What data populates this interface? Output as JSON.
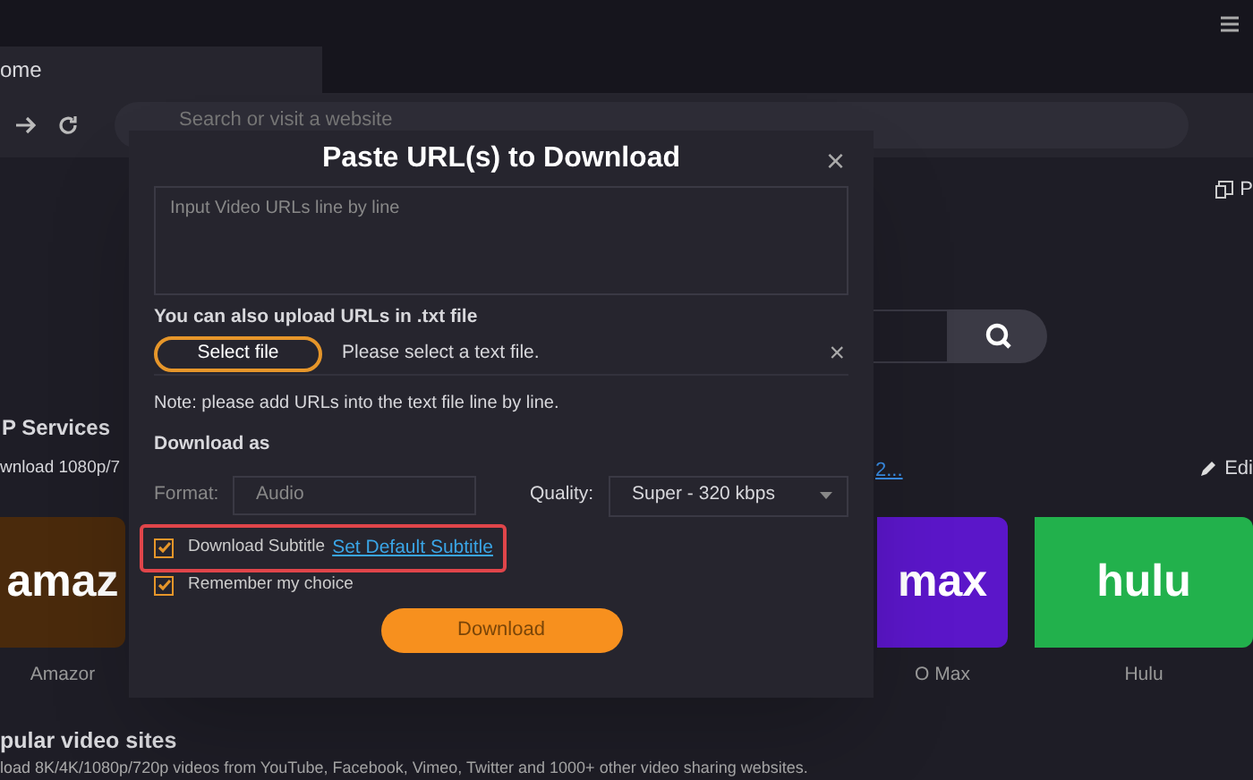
{
  "browser": {
    "tab_title": "ome",
    "address_placeholder": "Search or visit a website"
  },
  "page": {
    "top_right_label": "P",
    "section_title": "P Services",
    "section_subtitle": "wnload 1080p/7",
    "link_text": "2...",
    "edit_label": "Edi",
    "services": [
      {
        "logo_text": "amaz",
        "label": "Amazor",
        "color": "#4a2a0c"
      },
      {
        "logo_text": "max",
        "label": "O Max",
        "color": "#5b16c9"
      },
      {
        "logo_text": "hulu",
        "label": "Hulu",
        "color": "#22b14c"
      }
    ],
    "popular_title": "pular video sites",
    "popular_text": "load 8K/4K/1080p/720p videos from YouTube, Facebook, Vimeo, Twitter and 1000+ other video sharing websites."
  },
  "dialog": {
    "title": "Paste URL(s) to Download",
    "close": "×",
    "url_input": {
      "placeholder": "Input Video URLs line by line"
    },
    "upload_heading": "You can also upload URLs in .txt file",
    "select_file_button": "Select file",
    "file_status": "Please select a text file.",
    "clear": "×",
    "note": "Note: please add URLs into the text file line by line.",
    "download_as": "Download as",
    "format_label": "Format:",
    "format_value": "Audio",
    "quality_label": "Quality:",
    "quality_value": "Super - 320 kbps",
    "options": [
      {
        "label": "Download Subtitle",
        "checked": true,
        "link": "Set Default Subtitle",
        "highlighted": true
      },
      {
        "label": "Remember my choice",
        "checked": true,
        "highlighted": false
      }
    ],
    "download_button": {
      "label": "Download",
      "disabled": true
    }
  }
}
